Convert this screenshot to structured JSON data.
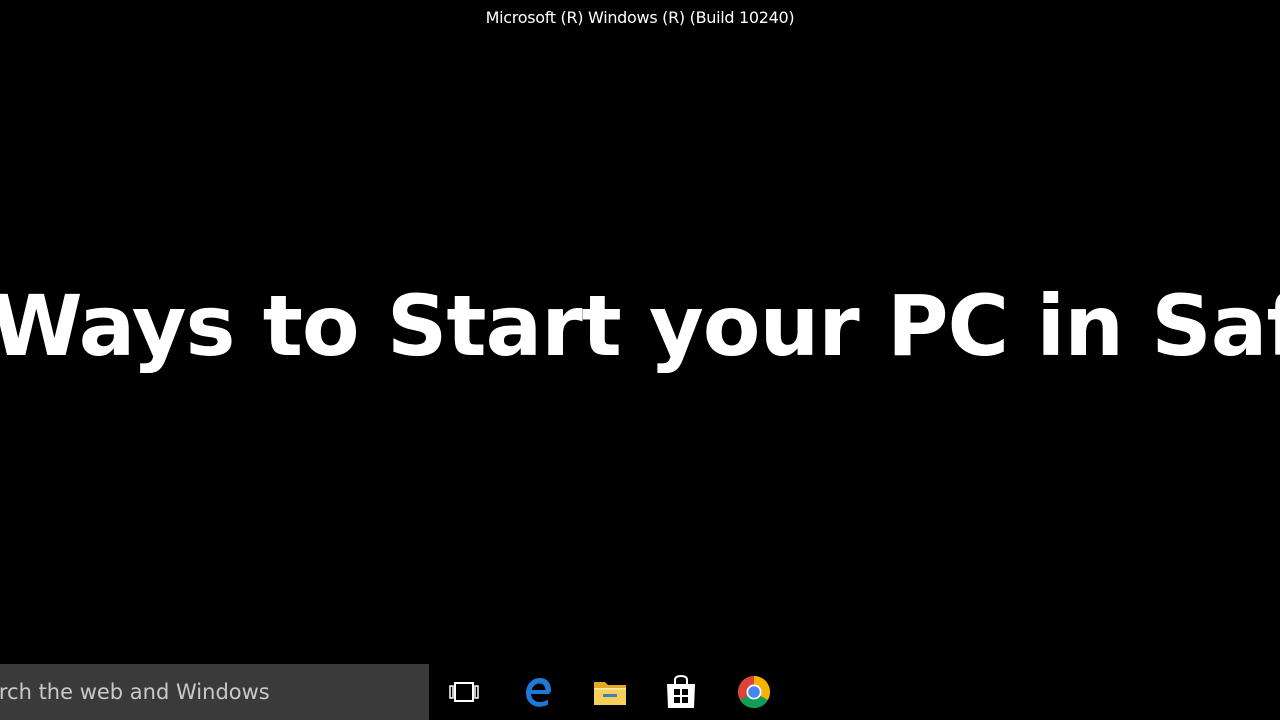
{
  "top_banner": {
    "build_text": "Microsoft (R) Windows (R) (Build 10240)"
  },
  "headline": {
    "text": "Ways to Start your PC in Safe Mod"
  },
  "taskbar": {
    "search": {
      "placeholder": "arch the web and Windows"
    },
    "icons": [
      {
        "name": "task-view-icon"
      },
      {
        "name": "edge-icon",
        "color": "#1e78d6"
      },
      {
        "name": "file-explorer-icon",
        "color": "#f4c542"
      },
      {
        "name": "store-icon"
      },
      {
        "name": "chrome-icon"
      }
    ]
  },
  "colors": {
    "background": "#000000",
    "search_box": "#3a3a3a",
    "text": "#ffffff"
  }
}
